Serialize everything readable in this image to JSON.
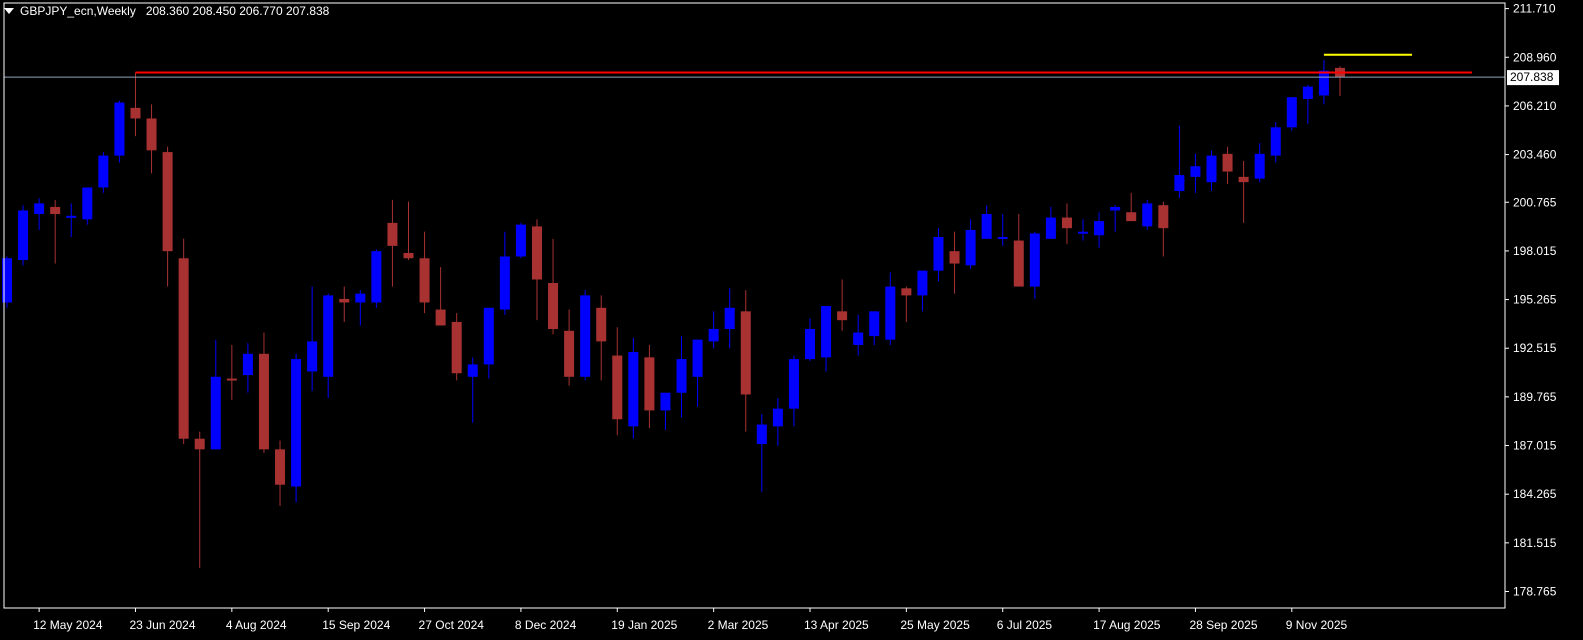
{
  "header": {
    "symbol": "GBPJPY_ecn,Weekly",
    "ohlc": "208.360 208.450 206.770 207.838"
  },
  "colors": {
    "background": "#000000",
    "bull": "#0000ff",
    "bear": "#a83232",
    "axis": "#ffffff",
    "resistance_line": "#ff0000",
    "target_line": "#ffff00",
    "price_line": "#8fa3b8"
  },
  "chart_data": {
    "type": "candlestick",
    "y_ticks": [
      "211.710",
      "208.960",
      "206.210",
      "203.460",
      "200.765",
      "198.015",
      "195.265",
      "192.515",
      "189.765",
      "187.015",
      "184.265",
      "181.515",
      "178.765"
    ],
    "ylim": [
      177.9,
      212.0
    ],
    "x_tick_labels": [
      {
        "label": "12 May 2024",
        "index": 2
      },
      {
        "label": "23 Jun 2024",
        "index": 8
      },
      {
        "label": "4 Aug 2024",
        "index": 14
      },
      {
        "label": "15 Sep 2024",
        "index": 20
      },
      {
        "label": "27 Oct 2024",
        "index": 26
      },
      {
        "label": "8 Dec 2024",
        "index": 32
      },
      {
        "label": "19 Jan 2025",
        "index": 38
      },
      {
        "label": "2 Mar 2025",
        "index": 44
      },
      {
        "label": "13 Apr 2025",
        "index": 50
      },
      {
        "label": "25 May 2025",
        "index": 56
      },
      {
        "label": "6 Jul 2025",
        "index": 62
      },
      {
        "label": "17 Aug 2025",
        "index": 68
      },
      {
        "label": "28 Sep 2025",
        "index": 74
      },
      {
        "label": "9 Nov 2025",
        "index": 80
      }
    ],
    "current_price": "207.838",
    "resistance_level": 208.1,
    "target_level": 209.1,
    "candles": [
      {
        "o": 195.1,
        "h": 197.7,
        "l": 194.8,
        "c": 197.6
      },
      {
        "o": 197.5,
        "h": 200.6,
        "l": 197.2,
        "c": 200.3
      },
      {
        "o": 200.1,
        "h": 201.0,
        "l": 199.2,
        "c": 200.7
      },
      {
        "o": 200.5,
        "h": 200.9,
        "l": 197.3,
        "c": 200.1
      },
      {
        "o": 199.9,
        "h": 200.7,
        "l": 198.8,
        "c": 200.0
      },
      {
        "o": 199.8,
        "h": 201.1,
        "l": 199.5,
        "c": 201.6
      },
      {
        "o": 201.6,
        "h": 203.6,
        "l": 201.3,
        "c": 203.4
      },
      {
        "o": 203.4,
        "h": 206.5,
        "l": 203.0,
        "c": 206.4
      },
      {
        "o": 206.1,
        "h": 208.1,
        "l": 204.5,
        "c": 205.5
      },
      {
        "o": 205.5,
        "h": 206.3,
        "l": 202.4,
        "c": 203.7
      },
      {
        "o": 203.6,
        "h": 203.9,
        "l": 196.0,
        "c": 198.0
      },
      {
        "o": 197.6,
        "h": 198.7,
        "l": 187.1,
        "c": 187.4
      },
      {
        "o": 187.4,
        "h": 187.8,
        "l": 180.1,
        "c": 186.8
      },
      {
        "o": 186.8,
        "h": 193.0,
        "l": 186.8,
        "c": 190.9
      },
      {
        "o": 190.8,
        "h": 192.7,
        "l": 189.6,
        "c": 190.7
      },
      {
        "o": 191.0,
        "h": 192.8,
        "l": 190.0,
        "c": 192.2
      },
      {
        "o": 192.2,
        "h": 193.4,
        "l": 186.6,
        "c": 186.8
      },
      {
        "o": 186.8,
        "h": 187.3,
        "l": 183.6,
        "c": 184.8
      },
      {
        "o": 184.7,
        "h": 192.2,
        "l": 183.8,
        "c": 191.9
      },
      {
        "o": 191.2,
        "h": 196.0,
        "l": 190.1,
        "c": 192.9
      },
      {
        "o": 190.9,
        "h": 195.6,
        "l": 189.7,
        "c": 195.5
      },
      {
        "o": 195.3,
        "h": 196.0,
        "l": 194.0,
        "c": 195.1
      },
      {
        "o": 195.1,
        "h": 195.8,
        "l": 193.8,
        "c": 195.6
      },
      {
        "o": 195.1,
        "h": 198.1,
        "l": 194.8,
        "c": 198.0
      },
      {
        "o": 199.6,
        "h": 200.9,
        "l": 196.0,
        "c": 198.3
      },
      {
        "o": 197.9,
        "h": 200.8,
        "l": 197.5,
        "c": 197.6
      },
      {
        "o": 197.6,
        "h": 199.1,
        "l": 194.5,
        "c": 195.1
      },
      {
        "o": 194.7,
        "h": 197.1,
        "l": 194.0,
        "c": 193.8
      },
      {
        "o": 194.0,
        "h": 194.5,
        "l": 190.7,
        "c": 191.1
      },
      {
        "o": 190.9,
        "h": 192.0,
        "l": 188.3,
        "c": 191.6
      },
      {
        "o": 191.6,
        "h": 194.5,
        "l": 190.8,
        "c": 194.8
      },
      {
        "o": 194.7,
        "h": 199.1,
        "l": 194.4,
        "c": 197.7
      },
      {
        "o": 197.7,
        "h": 199.6,
        "l": 197.6,
        "c": 199.5
      },
      {
        "o": 199.4,
        "h": 199.8,
        "l": 194.1,
        "c": 196.4
      },
      {
        "o": 196.2,
        "h": 198.7,
        "l": 193.3,
        "c": 193.6
      },
      {
        "o": 193.5,
        "h": 194.7,
        "l": 190.4,
        "c": 190.9
      },
      {
        "o": 190.9,
        "h": 195.8,
        "l": 190.7,
        "c": 195.5
      },
      {
        "o": 194.8,
        "h": 195.5,
        "l": 190.7,
        "c": 192.9
      },
      {
        "o": 192.1,
        "h": 193.7,
        "l": 187.6,
        "c": 188.5
      },
      {
        "o": 188.1,
        "h": 193.1,
        "l": 187.4,
        "c": 192.3
      },
      {
        "o": 192.0,
        "h": 192.7,
        "l": 188.0,
        "c": 189.0
      },
      {
        "o": 189.0,
        "h": 189.9,
        "l": 187.9,
        "c": 190.0
      },
      {
        "o": 190.0,
        "h": 193.2,
        "l": 188.6,
        "c": 191.9
      },
      {
        "o": 190.9,
        "h": 193.0,
        "l": 189.2,
        "c": 193.0
      },
      {
        "o": 192.9,
        "h": 194.6,
        "l": 192.5,
        "c": 193.6
      },
      {
        "o": 193.6,
        "h": 195.9,
        "l": 192.5,
        "c": 194.8
      },
      {
        "o": 194.6,
        "h": 195.8,
        "l": 187.8,
        "c": 189.9
      },
      {
        "o": 187.1,
        "h": 188.8,
        "l": 184.4,
        "c": 188.2
      },
      {
        "o": 188.1,
        "h": 189.7,
        "l": 187.0,
        "c": 189.1
      },
      {
        "o": 189.1,
        "h": 192.1,
        "l": 188.1,
        "c": 191.9
      },
      {
        "o": 191.9,
        "h": 194.2,
        "l": 191.8,
        "c": 193.6
      },
      {
        "o": 192.0,
        "h": 194.5,
        "l": 191.2,
        "c": 194.9
      },
      {
        "o": 194.6,
        "h": 196.4,
        "l": 193.5,
        "c": 194.1
      },
      {
        "o": 192.7,
        "h": 194.4,
        "l": 192.1,
        "c": 193.4
      },
      {
        "o": 193.2,
        "h": 194.6,
        "l": 192.7,
        "c": 194.6
      },
      {
        "o": 193.0,
        "h": 196.8,
        "l": 192.7,
        "c": 196.0
      },
      {
        "o": 195.9,
        "h": 196.0,
        "l": 194.0,
        "c": 195.5
      },
      {
        "o": 195.5,
        "h": 196.7,
        "l": 194.6,
        "c": 196.9
      },
      {
        "o": 196.9,
        "h": 199.3,
        "l": 196.3,
        "c": 198.8
      },
      {
        "o": 198.0,
        "h": 199.1,
        "l": 195.6,
        "c": 197.3
      },
      {
        "o": 197.2,
        "h": 199.8,
        "l": 197.0,
        "c": 199.2
      },
      {
        "o": 198.7,
        "h": 200.6,
        "l": 198.7,
        "c": 200.1
      },
      {
        "o": 198.8,
        "h": 200.1,
        "l": 198.3,
        "c": 198.8
      },
      {
        "o": 198.6,
        "h": 200.1,
        "l": 196.3,
        "c": 196.0
      },
      {
        "o": 196.0,
        "h": 199.1,
        "l": 195.3,
        "c": 199.0
      },
      {
        "o": 198.7,
        "h": 200.5,
        "l": 198.7,
        "c": 199.9
      },
      {
        "o": 199.9,
        "h": 200.7,
        "l": 198.4,
        "c": 199.3
      },
      {
        "o": 199.0,
        "h": 199.8,
        "l": 198.6,
        "c": 199.1
      },
      {
        "o": 198.9,
        "h": 200.2,
        "l": 198.2,
        "c": 199.7
      },
      {
        "o": 200.3,
        "h": 200.6,
        "l": 199.1,
        "c": 200.5
      },
      {
        "o": 200.2,
        "h": 201.3,
        "l": 199.7,
        "c": 199.7
      },
      {
        "o": 199.4,
        "h": 200.9,
        "l": 199.2,
        "c": 200.7
      },
      {
        "o": 200.6,
        "h": 200.8,
        "l": 197.7,
        "c": 199.3
      },
      {
        "o": 201.4,
        "h": 205.1,
        "l": 201.0,
        "c": 202.3
      },
      {
        "o": 202.2,
        "h": 203.5,
        "l": 201.3,
        "c": 202.8
      },
      {
        "o": 201.9,
        "h": 203.7,
        "l": 201.4,
        "c": 203.4
      },
      {
        "o": 203.5,
        "h": 203.9,
        "l": 201.8,
        "c": 202.5
      },
      {
        "o": 202.2,
        "h": 203.1,
        "l": 199.6,
        "c": 201.9
      },
      {
        "o": 202.1,
        "h": 204.1,
        "l": 201.9,
        "c": 203.5
      },
      {
        "o": 203.4,
        "h": 205.3,
        "l": 203.0,
        "c": 205.0
      },
      {
        "o": 205.0,
        "h": 206.7,
        "l": 204.8,
        "c": 206.7
      },
      {
        "o": 206.6,
        "h": 207.4,
        "l": 205.2,
        "c": 207.3
      },
      {
        "o": 206.8,
        "h": 208.8,
        "l": 206.3,
        "c": 208.2
      },
      {
        "o": 208.36,
        "h": 208.45,
        "l": 206.77,
        "c": 207.838
      }
    ]
  }
}
